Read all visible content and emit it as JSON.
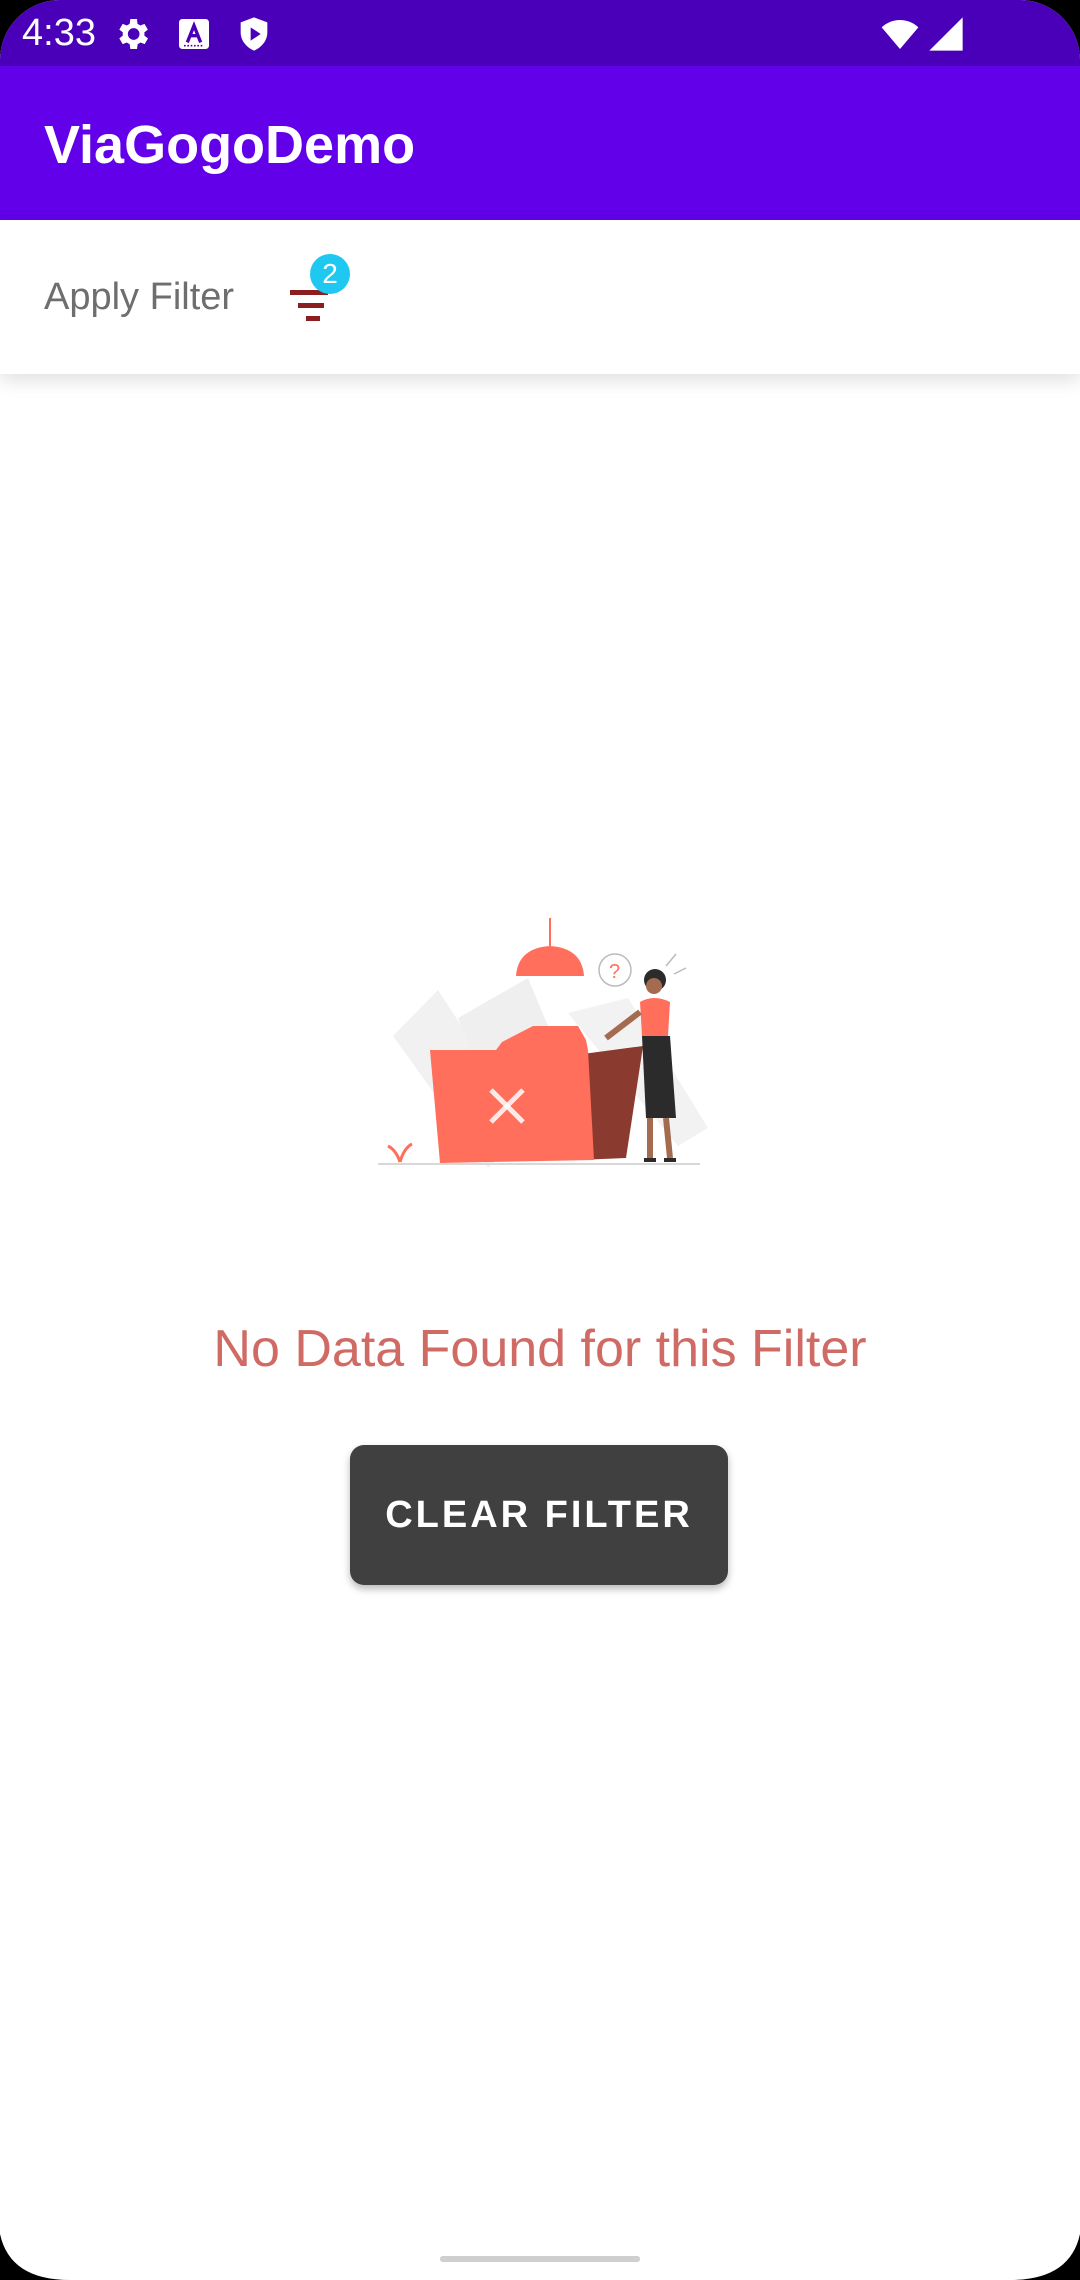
{
  "status_bar": {
    "time": "4:33",
    "left_icons": [
      "gear-icon",
      "a-badge-icon",
      "shield-play-icon"
    ],
    "right_icons": [
      "wifi-icon",
      "cell-signal-icon"
    ]
  },
  "app_bar": {
    "title": "ViaGogoDemo",
    "color": "#6200ea",
    "status_color": "#4a00b8"
  },
  "filter_bar": {
    "label": "Apply Filter",
    "icon": "filter-icon",
    "badge_count": "2",
    "badge_color": "#1fc8f0"
  },
  "empty_state": {
    "illustration": "empty-folder-illustration",
    "message": "No Data Found for this Filter",
    "message_color": "#d06a64",
    "button_label": "CLEAR FILTER"
  },
  "accent_colors": {
    "illustration_primary": "#ff6f5b",
    "illustration_dark": "#8a3a2e"
  }
}
